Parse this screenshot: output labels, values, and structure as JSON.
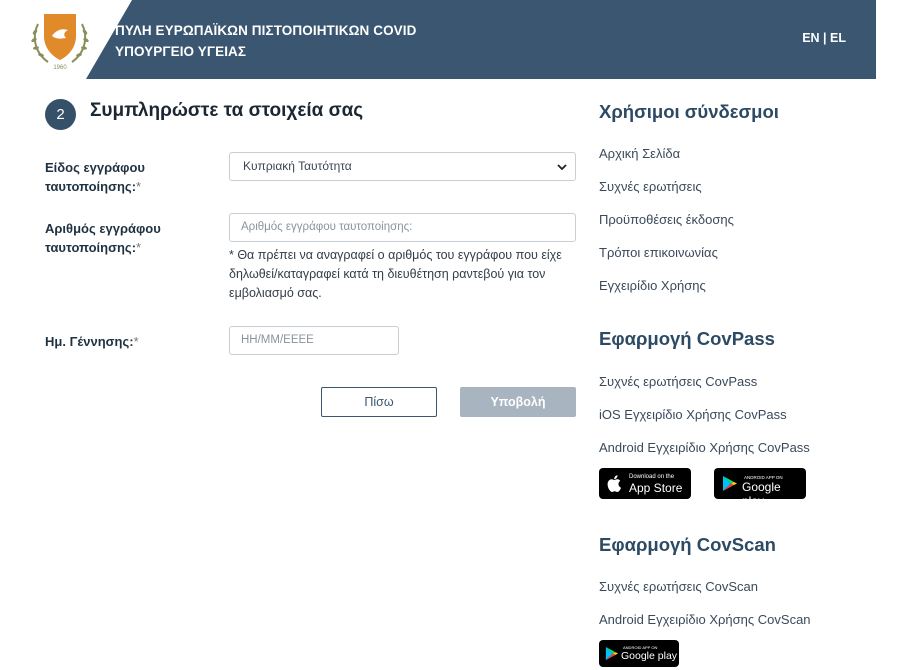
{
  "header": {
    "title_line1": "ΠΥΛΗ ΕΥΡΩΠΑΪΚΩΝ ΠΙΣΤΟΠΟΙΗΤΙΚΩΝ COVID",
    "title_line2": "ΥΠΟΥΡΓΕΙΟ ΥΓΕΙΑΣ",
    "lang_en": "EN",
    "lang_sep": " | ",
    "lang_el": "EL"
  },
  "step": {
    "number": "2",
    "title": "Συμπληρώστε τα στοιχεία σας"
  },
  "form": {
    "doc_type_label_1": "Είδος εγγράφου",
    "doc_type_label_2": "ταυτοποίησης:",
    "doc_type_value": "Κυπριακή Ταυτότητα",
    "doc_number_label_1": "Αριθμός εγγράφου",
    "doc_number_label_2": "ταυτοποίησης:",
    "doc_number_placeholder": "Αριθμός εγγράφου ταυτοποίησης:",
    "doc_number_note": "* Θα πρέπει να αναγραφεί ο αριθμός του εγγράφου που είχε δηλωθεί/καταγραφεί κατά τη διευθέτηση ραντεβού για τον εμβολιασμό σας.",
    "dob_label": "Ημ. Γέννησης:",
    "dob_placeholder": "ΗΗ/ΜΜ/ΕΕΕΕ",
    "required_mark": "*",
    "back_button": "Πίσω",
    "submit_button": "Υποβολή"
  },
  "sidebar": {
    "useful_links_heading": "Χρήσιμοι σύνδεσμοι",
    "useful_links": [
      "Αρχική Σελίδα",
      "Συχνές ερωτήσεις",
      "Προϋποθέσεις έκδοσης",
      "Τρόποι επικοινωνίας",
      "Εγχειρίδιο Χρήσης"
    ],
    "covpass_heading": "Εφαρμογή CovPass",
    "covpass_links": [
      "Συχνές ερωτήσεις CovPass",
      "iOS Εγχειρίδιο Χρήσης CovPass",
      "Android Εγχειρίδιο Χρήσης CovPass"
    ],
    "covscan_heading": "Εφαρμογή CovScan",
    "covscan_links": [
      "Συχνές ερωτήσεις CovScan",
      "Android Εγχειρίδιο Χρήσης CovScan"
    ]
  },
  "badges": {
    "appstore_small": "Download on the",
    "appstore_big": "App Store",
    "googleplay_small": "ANDROID APP ON",
    "googleplay_big": "Google play"
  },
  "colors": {
    "header_bg": "#3a5670",
    "accent": "#2c4a63",
    "submit_disabled": "#a8b4bf"
  }
}
